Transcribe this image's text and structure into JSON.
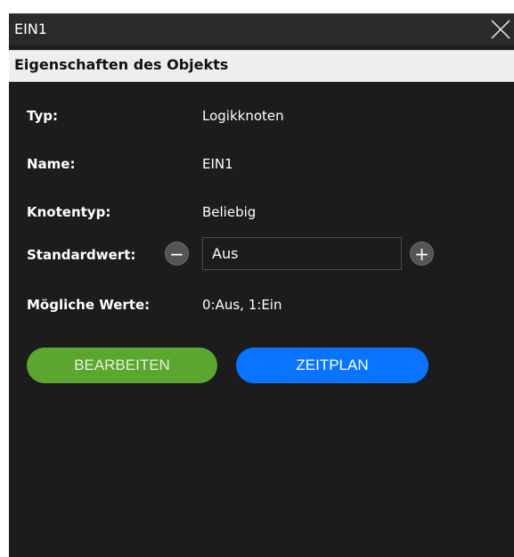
{
  "window": {
    "title": "EIN1",
    "close_icon": "close-icon"
  },
  "section": {
    "title": "Eigenschaften des Objekts"
  },
  "properties": {
    "typ": {
      "label": "Typ:",
      "value": "Logikknoten"
    },
    "name": {
      "label": "Name:",
      "value": "EIN1"
    },
    "knotentyp": {
      "label": "Knotentyp:",
      "value": "Beliebig"
    },
    "standardwert": {
      "label": "Standardwert:",
      "value": "Aus",
      "minus": "−",
      "plus": "+"
    },
    "moegliche_werte": {
      "label": "Mögliche Werte:",
      "value": "0:Aus, 1:Ein"
    }
  },
  "buttons": {
    "edit": {
      "label": "BEARBEITEN",
      "color": "#5aa62f"
    },
    "schedule": {
      "label": "ZEITPLAN",
      "color": "#0a74ff"
    }
  }
}
